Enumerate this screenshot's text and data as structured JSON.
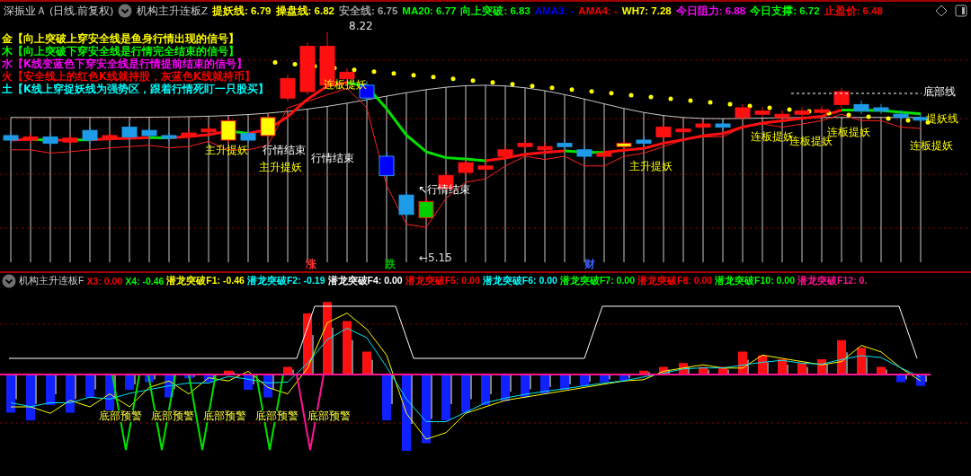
{
  "header": {
    "title": "深振业Ａ (日线.前复权)",
    "indicator": "机构主升连板Z",
    "readings": [
      {
        "text": "提妖线: 6.79",
        "color": "#ffff00"
      },
      {
        "text": "操盘线: 6.82",
        "color": "#ffff00"
      },
      {
        "text": "安全线: 6.75",
        "color": "#a0a0a0"
      },
      {
        "text": "MA20: 6.77",
        "color": "#00ff00"
      },
      {
        "text": "向上突破: 6.83",
        "color": "#00ff00"
      },
      {
        "text": "AMA3: -",
        "color": "#0000ff"
      },
      {
        "text": "AMA4: -",
        "color": "#ff0000"
      },
      {
        "text": "WH7: 7.28",
        "color": "#ffff00"
      },
      {
        "text": "今日阻力: 6.88",
        "color": "#ff00ff"
      },
      {
        "text": "今日支撑: 6.72",
        "color": "#00ff00"
      },
      {
        "text": "止盈价: 6.48",
        "color": "#ff0000"
      }
    ]
  },
  "legend": [
    {
      "text": "金【向上突破上穿安全线是鱼身行情出现的信号】",
      "color": "#ffff00"
    },
    {
      "text": "木【向上突破下穿安全线是行情完全结束的信号】",
      "color": "#00ff00"
    },
    {
      "text": "水【K线变蓝色下穿安全线是行情提前结束的信号】",
      "color": "#ff00ff"
    },
    {
      "text": "火【安全线上的红色K线就持股，灰蓝色K线就持币】",
      "color": "#ff0000"
    },
    {
      "text": "土【K线上穿捉妖线为强势区，跟着行情死盯一只股买】",
      "color": "#00ffff"
    }
  ],
  "price_marks": [
    "8.22",
    "←5.15"
  ],
  "chart_labels": [
    {
      "text": "连板提妖",
      "kind": "yellow"
    },
    {
      "text": "底部线",
      "kind": "white"
    },
    {
      "text": "提妖线",
      "kind": "yellow"
    },
    {
      "text": "连板提妖",
      "kind": "yellow"
    },
    {
      "text": "连板提妖",
      "kind": "yellow"
    },
    {
      "text": "连板提妖",
      "kind": "yellow"
    },
    {
      "text": "连板提妖",
      "kind": "yellow"
    },
    {
      "text": "主升提妖",
      "kind": "yellow"
    },
    {
      "text": "行情结束",
      "kind": "white"
    },
    {
      "text": "行情结束",
      "kind": "white"
    },
    {
      "text": "主升提妖",
      "kind": "yellow"
    },
    {
      "text": "主升提妖",
      "kind": "yellow"
    },
    {
      "text": "↖行情结束",
      "kind": "white"
    }
  ],
  "date_marks": [
    {
      "text": "涨",
      "color": "#ff3030"
    },
    {
      "text": "跌",
      "color": "#00c000"
    },
    {
      "text": "财",
      "color": "#4060ff"
    }
  ],
  "sub_panel": {
    "indicator": "机构主升连板F",
    "readings": [
      {
        "text": "X3: 0.00",
        "color": "#ff0000"
      },
      {
        "text": "X4: -0.46",
        "color": "#00ff00"
      },
      {
        "text": "潜龙突破F1: -0.46",
        "color": "#ffff00"
      },
      {
        "text": "潜龙突破F2: -0.19",
        "color": "#00ffff"
      },
      {
        "text": "潜龙突破F4: 0.00",
        "color": "#ffffff"
      },
      {
        "text": "潜龙突破F5: 0.00",
        "color": "#ff0000"
      },
      {
        "text": "潜龙突破F6: 0.00",
        "color": "#00ffff"
      },
      {
        "text": "潜龙突破F7: 0.00",
        "color": "#00ff00"
      },
      {
        "text": "潜龙突破F8: 0.00",
        "color": "#ff0000"
      },
      {
        "text": "潜龙突破F10: 0.00",
        "color": "#00ff00"
      },
      {
        "text": "潜龙突破F12: 0.",
        "color": "#ff1493"
      }
    ],
    "warnings": [
      "底部预警",
      "底部预警",
      "底部预警",
      "底部预警",
      "底部预警"
    ]
  }
}
